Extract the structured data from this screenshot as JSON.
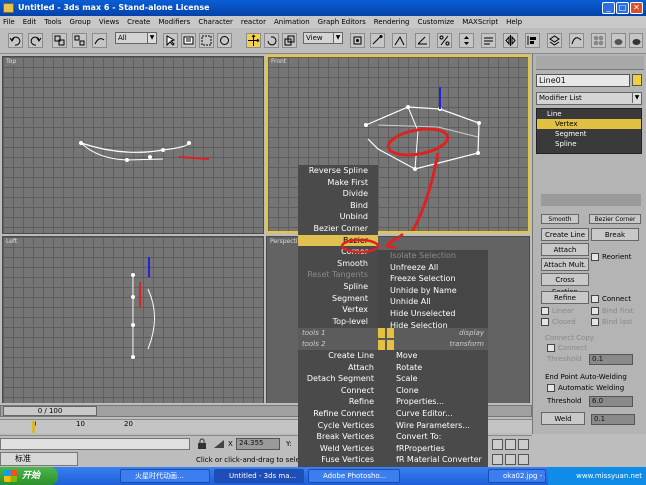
{
  "window": {
    "title": "Untitled - 3ds max 6 - Stand-alone License",
    "min": "_",
    "max": "□",
    "close": "✕"
  },
  "menu": [
    "File",
    "Edit",
    "Tools",
    "Group",
    "Views",
    "Create",
    "Modifiers",
    "Character",
    "reactor",
    "Animation",
    "Graph Editors",
    "Rendering",
    "Customize",
    "MAXScript",
    "Help"
  ],
  "toolbar": {
    "selection_filter": "All",
    "ref_coord": "View"
  },
  "viewports": {
    "top": "Top",
    "front": "Front",
    "left": "Left",
    "perspective": "Perspective"
  },
  "command_panel": {
    "object_name": "Line01",
    "modifier_list": "Modifier List",
    "stack": [
      "Line",
      "Vertex",
      "Segment",
      "Spline"
    ],
    "smooth": "Smooth",
    "bezier_corner": "Bezier Corner",
    "create_line": "Create Line",
    "break": "Break",
    "attach": "Attach",
    "reorient": "Reorient",
    "attach_mult": "Attach Mult.",
    "cross_section": "Cross Section",
    "refine": "Refine",
    "connect": "Connect",
    "linear": "Linear",
    "bind_first": "Bind first",
    "closed": "Closed",
    "bind_last": "Bind last",
    "connect_copy": "Connect Copy",
    "connect_chk": "Connect",
    "threshold": "Threshold",
    "threshold_val": "0.1",
    "endpoint_welding": "End Point Auto-Welding",
    "auto_welding": "Automatic Welding",
    "threshold2": "Threshold",
    "threshold2_val": "6.0",
    "weld": "Weld",
    "weld_val": "0.1"
  },
  "quad_menu": {
    "left_top": [
      "Reverse Spline",
      "Make First",
      "Divide",
      "Bind",
      "Unbind",
      "Bezier Corner",
      "Bezier",
      "Corner",
      "Smooth",
      "Reset Tangents",
      "Spline",
      "Segment",
      "Vertex",
      "Top-level"
    ],
    "right_top": [
      "Isolate Selection",
      "Unfreeze All",
      "Freeze Selection",
      "Unhide by Name",
      "Unhide All",
      "Hide Unselected",
      "Hide Selection"
    ],
    "tools1": "tools 1",
    "display": "display",
    "tools2": "tools 2",
    "transform": "transform",
    "left_bottom": [
      "Create Line",
      "Attach",
      "Detach Segment",
      "Connect",
      "Refine",
      "Refine Connect",
      "Cycle Vertices",
      "Break Vertices",
      "Weld Vertices",
      "Fuse Vertices"
    ],
    "right_bottom": [
      "Move",
      "Rotate",
      "Scale",
      "Clone",
      "Properties...",
      "Curve Editor...",
      "Wire Parameters...",
      "Convert To:",
      "fRProperties",
      "fR Material Converter",
      "VRay properties"
    ]
  },
  "timeline": {
    "frame": "0 / 100",
    "ticks": [
      "0",
      "10",
      "20"
    ]
  },
  "status": {
    "lang": "标准",
    "coord_x": "24.355",
    "coord_y_label": "Y:",
    "prompt": "Click or click-and-drag to select ob"
  },
  "taskbar": {
    "start": "开始",
    "tasks": [
      "火星时代动画...",
      "Untitled - 3ds ma...",
      "Adobe Photosho..."
    ],
    "tray": "www.missyuan.net",
    "right_task": "oka02.jpg - Ac"
  }
}
